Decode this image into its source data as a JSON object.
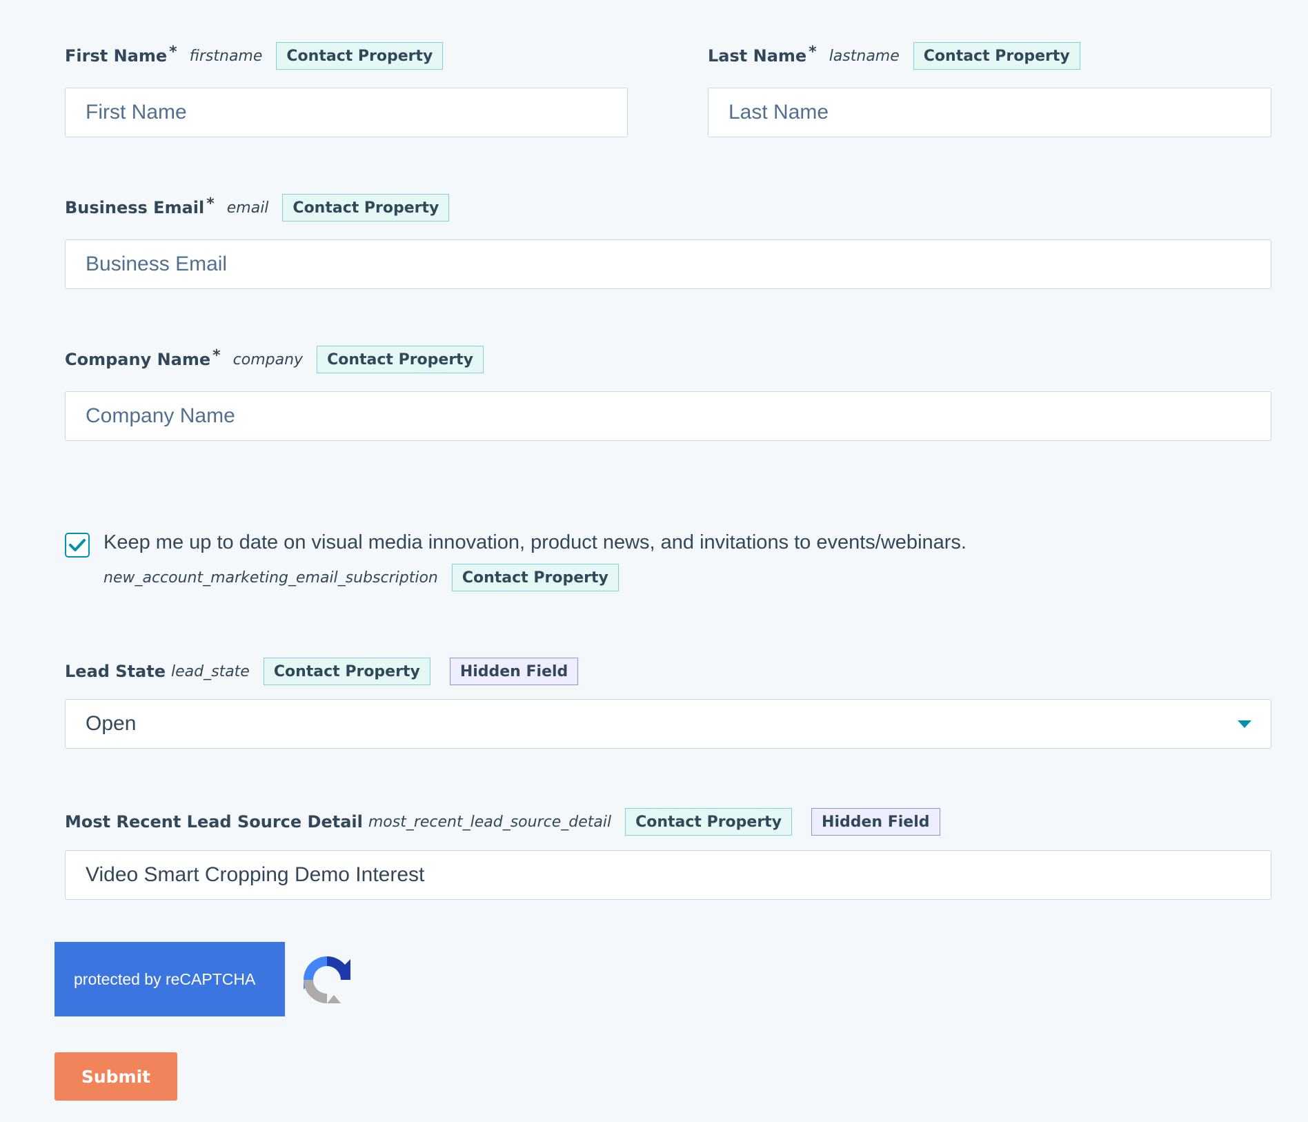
{
  "tags": {
    "contact": "Contact Property",
    "hidden": "Hidden Field"
  },
  "required_marker": "*",
  "fields": {
    "first_name": {
      "label": "First Name",
      "internal": "firstname",
      "placeholder": "First Name"
    },
    "last_name": {
      "label": "Last Name",
      "internal": "lastname",
      "placeholder": "Last Name"
    },
    "email": {
      "label": "Business Email",
      "internal": "email",
      "placeholder": "Business Email"
    },
    "company": {
      "label": "Company Name",
      "internal": "company",
      "placeholder": "Company Name"
    },
    "lead_state": {
      "label": "Lead State",
      "internal": "lead_state",
      "value": "Open"
    },
    "lead_source": {
      "label": "Most Recent Lead Source Detail",
      "internal": "most_recent_lead_source_detail",
      "value": "Video Smart Cropping Demo Interest"
    }
  },
  "consent": {
    "text": "Keep me up to date on visual media innovation, product news, and invitations to events/webinars.",
    "internal": "new_account_marketing_email_subscription",
    "checked": true
  },
  "recaptcha": {
    "text": "protected by reCAPTCHA"
  },
  "submit": {
    "label": "Submit"
  },
  "colors": {
    "background": "#f5f8fa",
    "submit": "#f2845c",
    "recaptcha": "#3b75e0",
    "accent": "#0091ae"
  },
  "icons": {
    "checkbox": "checkmark-icon",
    "dropdown": "chevron-down-icon",
    "recaptcha": "recaptcha-logo-icon"
  }
}
